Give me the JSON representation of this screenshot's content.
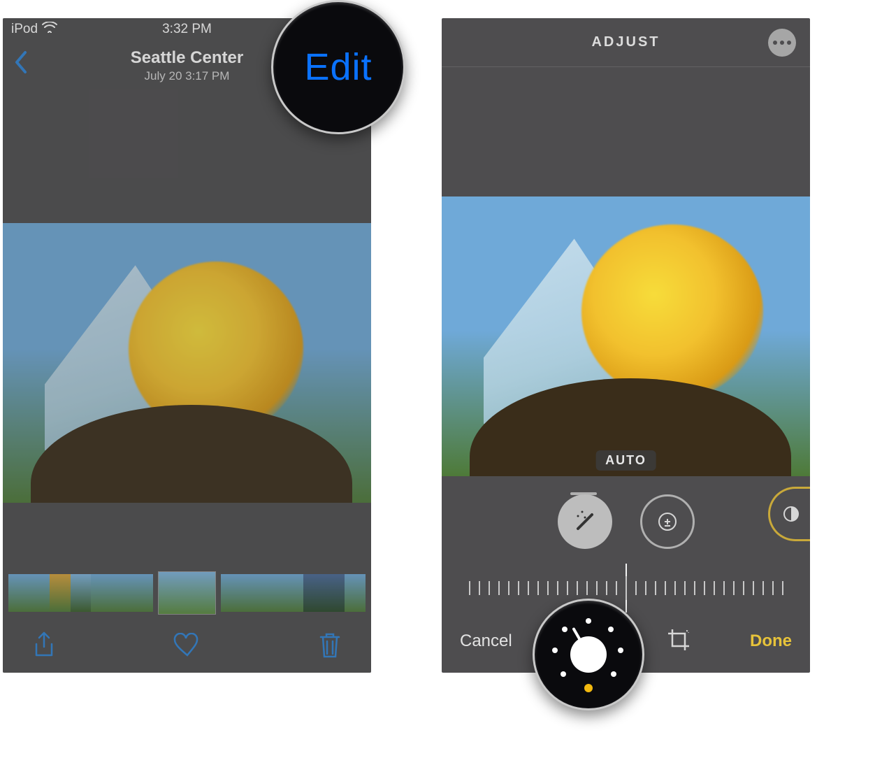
{
  "left_phone": {
    "status": {
      "device": "iPod",
      "time": "3:32 PM"
    },
    "nav": {
      "title": "Seattle Center",
      "subtitle": "July 20  3:17 PM",
      "edit_label": "Edit"
    },
    "toolbar_bottom": {
      "share": "share-icon",
      "favorite": "heart-icon",
      "delete": "trash-icon"
    }
  },
  "right_phone": {
    "header": {
      "title": "ADJUST"
    },
    "badge": "AUTO",
    "tools": {
      "auto": "magic-wand-icon",
      "exposure": "exposure-icon",
      "brilliance": "brilliance-icon"
    },
    "bottom": {
      "cancel_label": "Cancel",
      "done_label": "Done"
    }
  },
  "callouts": {
    "edit_magnified": "Edit"
  },
  "colors": {
    "ios_blue": "#0a72ff",
    "ios_yellow": "#e7c33a",
    "bg_gray": "#4e4d4f"
  }
}
